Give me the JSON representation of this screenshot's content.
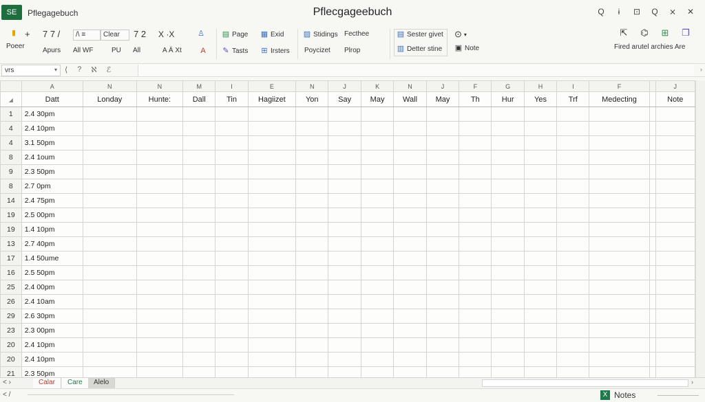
{
  "titlebar": {
    "app_badge": "SE",
    "doc_name": "Pflegagebuch",
    "window_title": "Pflecgageebuch",
    "controls": [
      "Q",
      "ɨ",
      "⊡",
      "Q",
      "⨯",
      "✕"
    ]
  },
  "ribbon": {
    "paste_label": "Poeer",
    "plus": "+",
    "font_name": "7 7 /",
    "apurs": "Apurs",
    "all_wf": "All WF",
    "box1_text": "/\\ ≡",
    "clear": "Clear",
    "size": "7 2",
    "x_icons": "X  ·X",
    "pu": "PU",
    "ali": "Al‌l",
    "format_marks": "A  Ä  Xt",
    "page": "Page",
    "tasts": "Tasts",
    "exid": "Exid",
    "irsters": "Irsters",
    "stidings": "Stidings",
    "poyciizet": "Poycizet",
    "fecthree": "Fecthee",
    "pliop": "Plrop",
    "sester_givet": "Sester givet",
    "detter_stine": "Detter stine",
    "clock_label": "⊙",
    "note": "Note",
    "right_labels": "Fired arutel archies Are"
  },
  "formula_bar": {
    "namebox": "vrs",
    "icons": [
      "⟨",
      "?",
      "ℵ",
      "ℰ"
    ]
  },
  "grid": {
    "col_letters": [
      "A",
      "N",
      "N",
      "M",
      "I",
      "E",
      "N",
      "J",
      "K",
      "N",
      "J",
      "F",
      "G",
      "H",
      "I",
      "F",
      "",
      "J"
    ],
    "headers": [
      "Datt",
      "Londay",
      "Hunte:",
      "Dall",
      "Tin",
      "Hagiizet",
      "Yon",
      "Say",
      "May",
      "Wall",
      "May",
      "Th",
      "Hur",
      "Yes",
      "Trf",
      "Medecting",
      "",
      "Note"
    ],
    "rows": [
      {
        "num": "1",
        "time": "2.4 30pm"
      },
      {
        "num": "4",
        "time": "2.4 10pm"
      },
      {
        "num": "4",
        "time": "3.1 50pm"
      },
      {
        "num": "8",
        "time": "2.4 1oum"
      },
      {
        "num": "9",
        "time": "2.3 50pm"
      },
      {
        "num": "8",
        "time": "2.7 0pm"
      },
      {
        "num": "14",
        "time": "2.4 75pm"
      },
      {
        "num": "19",
        "time": "2.5 00pm"
      },
      {
        "num": "19",
        "time": "1.4 10pm"
      },
      {
        "num": "13",
        "time": "2.7 40pm"
      },
      {
        "num": "17",
        "time": "1.4 50ume"
      },
      {
        "num": "16",
        "time": "2.5 50pm"
      },
      {
        "num": "25",
        "time": "2.4 00pm"
      },
      {
        "num": "26",
        "time": "2.4 10am"
      },
      {
        "num": "29",
        "time": "2.6 30pm"
      },
      {
        "num": "23",
        "time": "2.3 00pm"
      },
      {
        "num": "20",
        "time": "2.4 10pm"
      },
      {
        "num": "20",
        "time": "2.4 10pm"
      },
      {
        "num": "21",
        "time": "2.3 50pm"
      }
    ]
  },
  "tabs": {
    "nav": "<  ›",
    "items": [
      "Calar",
      "Care",
      "Alelo"
    ]
  },
  "statusbar": {
    "left": "< /",
    "notes": "Notes",
    "notes_icon": "X"
  }
}
